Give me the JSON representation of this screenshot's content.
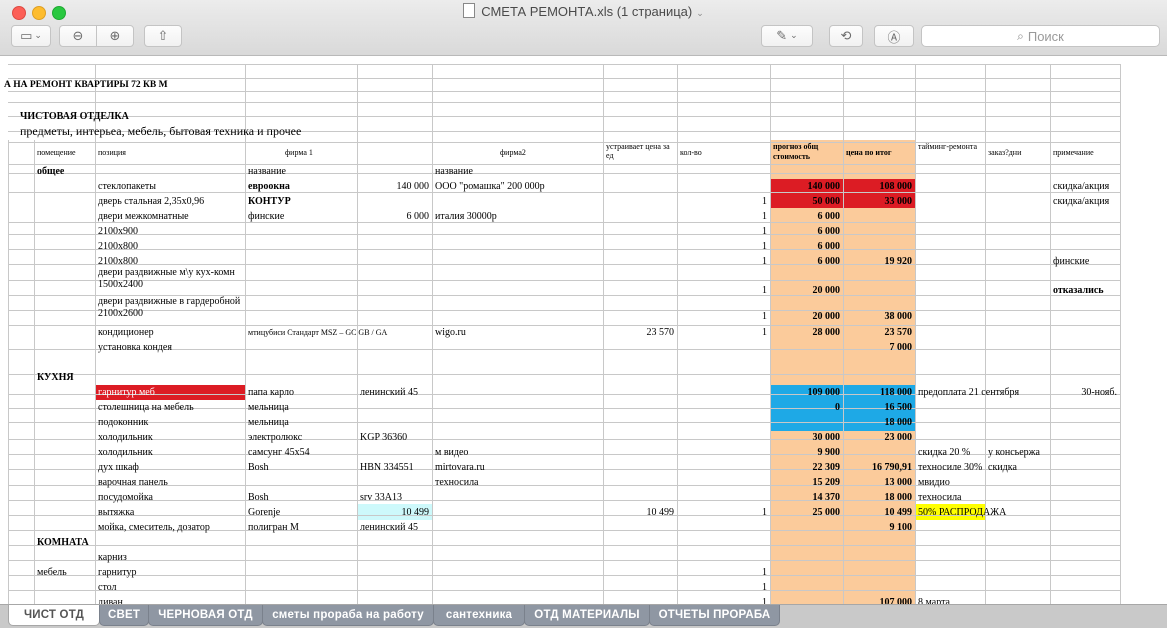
{
  "window": {
    "title": "СМЕТА РЕМОНТА.xls (1 страница)",
    "search_placeholder": "Поиск"
  },
  "sheet": {
    "title": "А НА РЕМОНТ КВАРТИРЫ 72 КВ М",
    "section": "ЧИСТОВАЯ ОТДЕЛКА",
    "subtitle": "предметы, интерьеа, мебель, бытовая техника и прочее",
    "headers": {
      "room": "помещение",
      "position": "позиция",
      "firm1": "фирма 1",
      "firm2": "фирма2",
      "installer_price": "устраивает цена за ед",
      "qty": "кол-во",
      "forecast": "прогноз общ стоимость",
      "total": "цена по итог",
      "timing": "тайминг-ремонта",
      "order": "заказ?дни",
      "note": "примечание"
    },
    "general_label": "общее",
    "name_label_1": "название",
    "name_label_2": "название",
    "kitchen_label": "КУХНЯ",
    "room_label": "КОМНАТА",
    "rows": {
      "r1": {
        "pos": "стеклопакеты",
        "f1": "евроокна",
        "f1v": "140 000",
        "f2": "ООО \"ромашка\"  200 000р",
        "fc": "140 000",
        "tot": "108 000",
        "note": "скидка/акция"
      },
      "r2": {
        "pos": "дверь стальная 2,35х0,96",
        "f1": "КОНТУР",
        "qty": "1",
        "fc": "50 000",
        "tot": "33 000",
        "note": "скидка/акция"
      },
      "r3": {
        "pos": "двери межкомнатные",
        "f1": "финские",
        "f1v": "6 000",
        "f2": "италия  30000р",
        "qty": "1",
        "fc": "6 000"
      },
      "r4": {
        "pos": "2100х900",
        "qty": "1",
        "fc": "6 000"
      },
      "r5": {
        "pos": "2100х800",
        "qty": "1",
        "fc": "6 000"
      },
      "r6": {
        "pos": "2100х800",
        "qty": "1",
        "fc": "6 000",
        "tot": "19 920",
        "note": "финские"
      },
      "r7": {
        "pos": "двери раздвижные м\\у кух-комн 1500х2400",
        "qty": "1",
        "fc": "20 000",
        "note": "отказались"
      },
      "r8": {
        "pos": "двери раздвижные в гардеробной 2100х2600",
        "qty": "1",
        "fc": "20 000",
        "tot": "38 000"
      },
      "r9": {
        "pos": "кондиционер",
        "f1": "мтицубиси Стандарт MSZ – GC  GB / GA",
        "f2": "wigo.ru",
        "price": "23 570",
        "qty": "1",
        "fc": "28 000",
        "tot": "23 570"
      },
      "r10": {
        "pos": "установка кондея",
        "tot": "7 000"
      },
      "k1": {
        "pos": "гарнитур меб",
        "f1": "папа карло",
        "f1b": "ленинский 45",
        "fc": "109 000",
        "tot": "118 000",
        "timing": "предоплата 21 сентября",
        "note": "30-нояб."
      },
      "k2": {
        "pos": "столешница на мебель",
        "f1": "мельница",
        "fc": "0",
        "tot": "16 500"
      },
      "k3": {
        "pos": "подоконник",
        "f1": "мельница",
        "tot": "18 000"
      },
      "k4": {
        "pos": "холодильник",
        "f1": "электролюкс",
        "f1b": "KGP 36360",
        "fc": "30 000",
        "tot": "23 000"
      },
      "k5": {
        "pos": "холодильник",
        "f1": "самсунг 45х54",
        "f2": "м видео",
        "fc": "9 900",
        "timing": "скидка 20 %",
        "order": "у консьержа"
      },
      "k6": {
        "pos": "дух шкаф",
        "f1": "Bosh",
        "f1b": "HBN 334551",
        "f2": "mirtovara.ru",
        "fc": "22 309",
        "tot": "16 790,91",
        "timing": "техносиле  30%",
        "order": "скидка"
      },
      "k7": {
        "pos": "варочная панель",
        "f2": "техносила",
        "fc": "15 209",
        "tot": "13 000",
        "timing": "мвидио"
      },
      "k8": {
        "pos": "посудомойка",
        "f1": "Bosh",
        "f1b": "srv 33A13",
        "fc": "14 370",
        "tot": "18 000",
        "timing": "техносила"
      },
      "k9": {
        "pos": "вытяжка",
        "f1": "Gorenje",
        "f1b": "10 499",
        "price": "10 499",
        "qty": "1",
        "fc": "25 000",
        "tot": "10 499",
        "timing": "50% РАСПРОДАЖА"
      },
      "k10": {
        "pos": "мойка, смеситель, дозатор",
        "f1": "полигран М",
        "f1b": "ленинский 45",
        "tot": "9 100"
      },
      "c1": {
        "pos": "карниз"
      },
      "c2": {
        "room": "мебель",
        "pos": "гарнитур",
        "qty": "1"
      },
      "c3": {
        "pos": "стол",
        "qty": "1"
      },
      "c4": {
        "pos": "диван",
        "qty": "1",
        "tot": "107 000",
        "timing": "8 марта"
      }
    }
  },
  "tabs": [
    "ЧИСТ ОТД",
    "СВЕТ",
    "ЧЕРНОВАЯ ОТД",
    "сметы прораба на работу",
    "сантехника",
    "ОТД МАТЕРИАЛЫ",
    "ОТЧЕТЫ ПРОРАБА"
  ],
  "colors": {
    "orange": "#fbcb9b",
    "red": "#dc1c24",
    "blue": "#1ea9e6",
    "yellow": "#ffff00",
    "cyan": "#cdf9fb"
  }
}
